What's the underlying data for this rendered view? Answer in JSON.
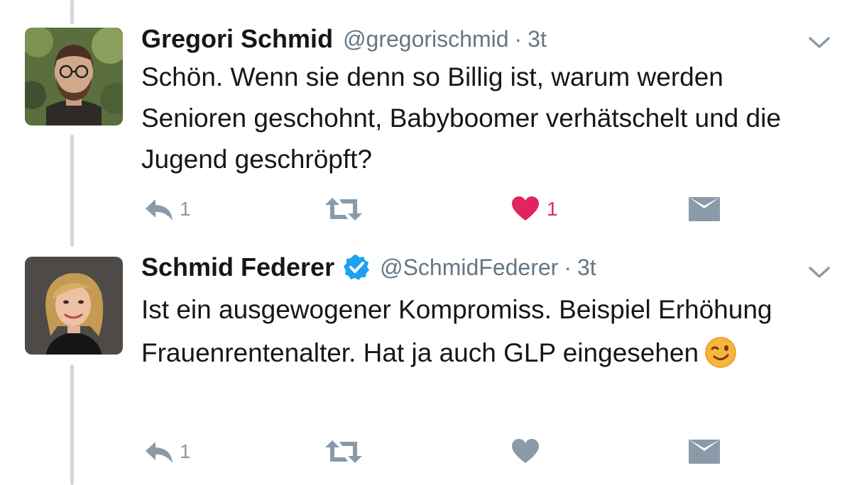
{
  "tweets": [
    {
      "name": "Gregori Schmid",
      "handle": "@gregorischmid",
      "separator": "·",
      "time": "3t",
      "verified": false,
      "text": "Schön. Wenn sie denn so Billig ist, warum werden Senioren geschohnt, Babyboomer verhätschelt und die Jugend geschröpft?",
      "reply_count": "1",
      "retweet_count": "",
      "like_count": "1",
      "liked": true,
      "avatar_icon": "bearded-man-with-glasses-photo"
    },
    {
      "name": "Schmid Federer",
      "handle": "@SchmidFederer",
      "separator": "·",
      "time": "3t",
      "verified": true,
      "text": "Ist ein ausgewogener Kompromiss. Beispiel Erhöhung Frauenrentenalter. Hat ja auch GLP eingesehen",
      "emoji": "winking-face",
      "reply_count": "1",
      "retweet_count": "",
      "like_count": "",
      "liked": false,
      "avatar_icon": "blonde-woman-portrait-photo"
    }
  ],
  "colors": {
    "text": "#14171a",
    "secondary": "#657786",
    "action_icon": "#8a9aa8",
    "like_active": "#e0245e",
    "verified": "#1da1f2",
    "thread_line": "#cfd9de"
  }
}
